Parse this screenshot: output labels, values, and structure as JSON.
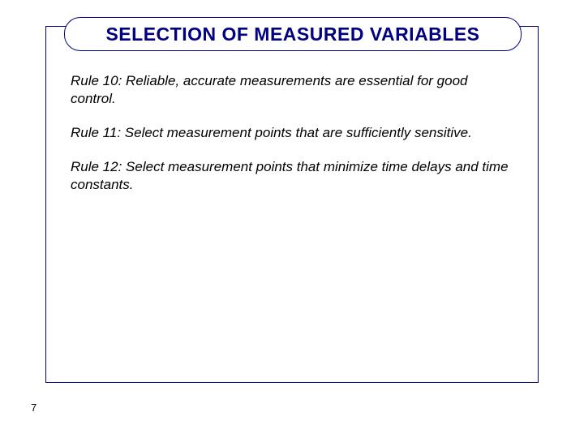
{
  "slide": {
    "title": "SELECTION OF MEASURED VARIABLES",
    "rules": [
      "Rule 10: Reliable, accurate measurements are essential for good control.",
      "Rule 11: Select measurement points that are sufficiently sensitive.",
      "Rule 12: Select measurement points that minimize time delays and time constants."
    ],
    "page_number": "7"
  }
}
